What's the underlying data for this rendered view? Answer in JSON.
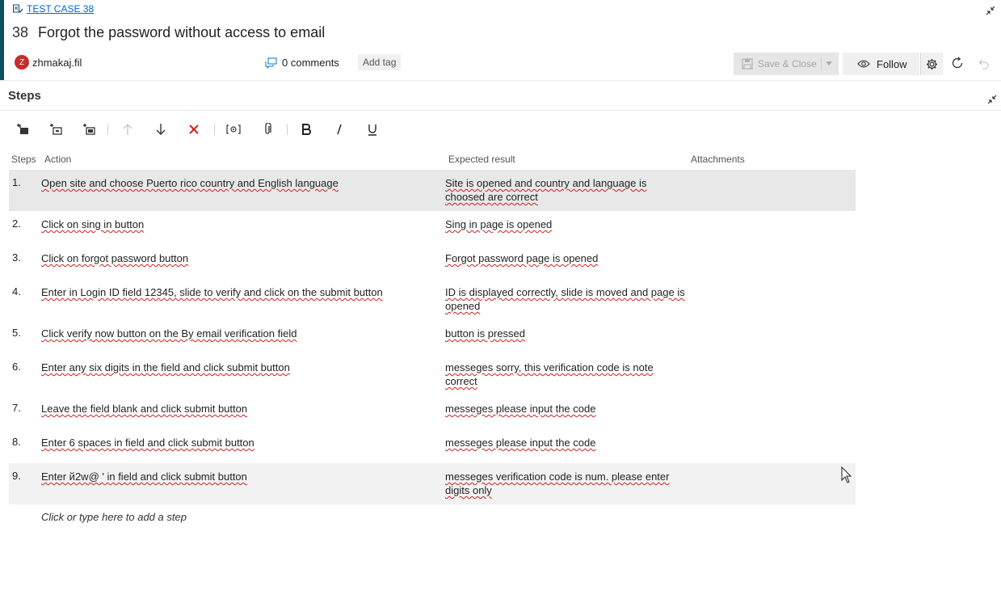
{
  "work_item": {
    "type_label": "TEST CASE 38",
    "id": "38",
    "title": "Forgot the password without access to email",
    "assignee_initial": "Z",
    "assignee": "zhmakaj.fil",
    "comments": "0 comments",
    "add_tag": "Add tag",
    "accent_color": "#0b4f60"
  },
  "toolbar": {
    "save_close": "Save & Close",
    "follow": "Follow"
  },
  "steps_section": {
    "title": "Steps",
    "columns": [
      "Steps",
      "Action",
      "Expected result",
      "Attachments"
    ],
    "add_step_placeholder": "Click or type here to add a step",
    "rows": [
      {
        "num": "1.",
        "action": "Open site and choose Puerto rico country and English language",
        "expected": "Site is opened and country and language is choosed are correct"
      },
      {
        "num": "2.",
        "action": "Click on sing in button",
        "expected": "Sing in page is opened"
      },
      {
        "num": "3.",
        "action": "Click on forgot password button",
        "expected": "Forgot password page is opened"
      },
      {
        "num": "4.",
        "action": "Enter in Login ID field 12345, slide to verify and click on the submit button",
        "expected": "ID is displayed correctly, slide is moved and page is opened"
      },
      {
        "num": "5.",
        "action": "Click verify now button on the By email verification field",
        "expected": "button is pressed"
      },
      {
        "num": "6.",
        "action": "Enter any six digits in the field and click submit button",
        "expected": "messeges sorry, this verification code is note correct"
      },
      {
        "num": "7.",
        "action": "Leave the field blank and click submit button",
        "expected": "messeges please input the code"
      },
      {
        "num": "8.",
        "action": "Enter 6 spaces in field and click submit button",
        "expected": "messeges please input the code"
      },
      {
        "num": "9.",
        "action": "Enter й2w@ ' in field and click submit button",
        "expected": "messeges verification code is num. please enter digits only"
      }
    ]
  }
}
